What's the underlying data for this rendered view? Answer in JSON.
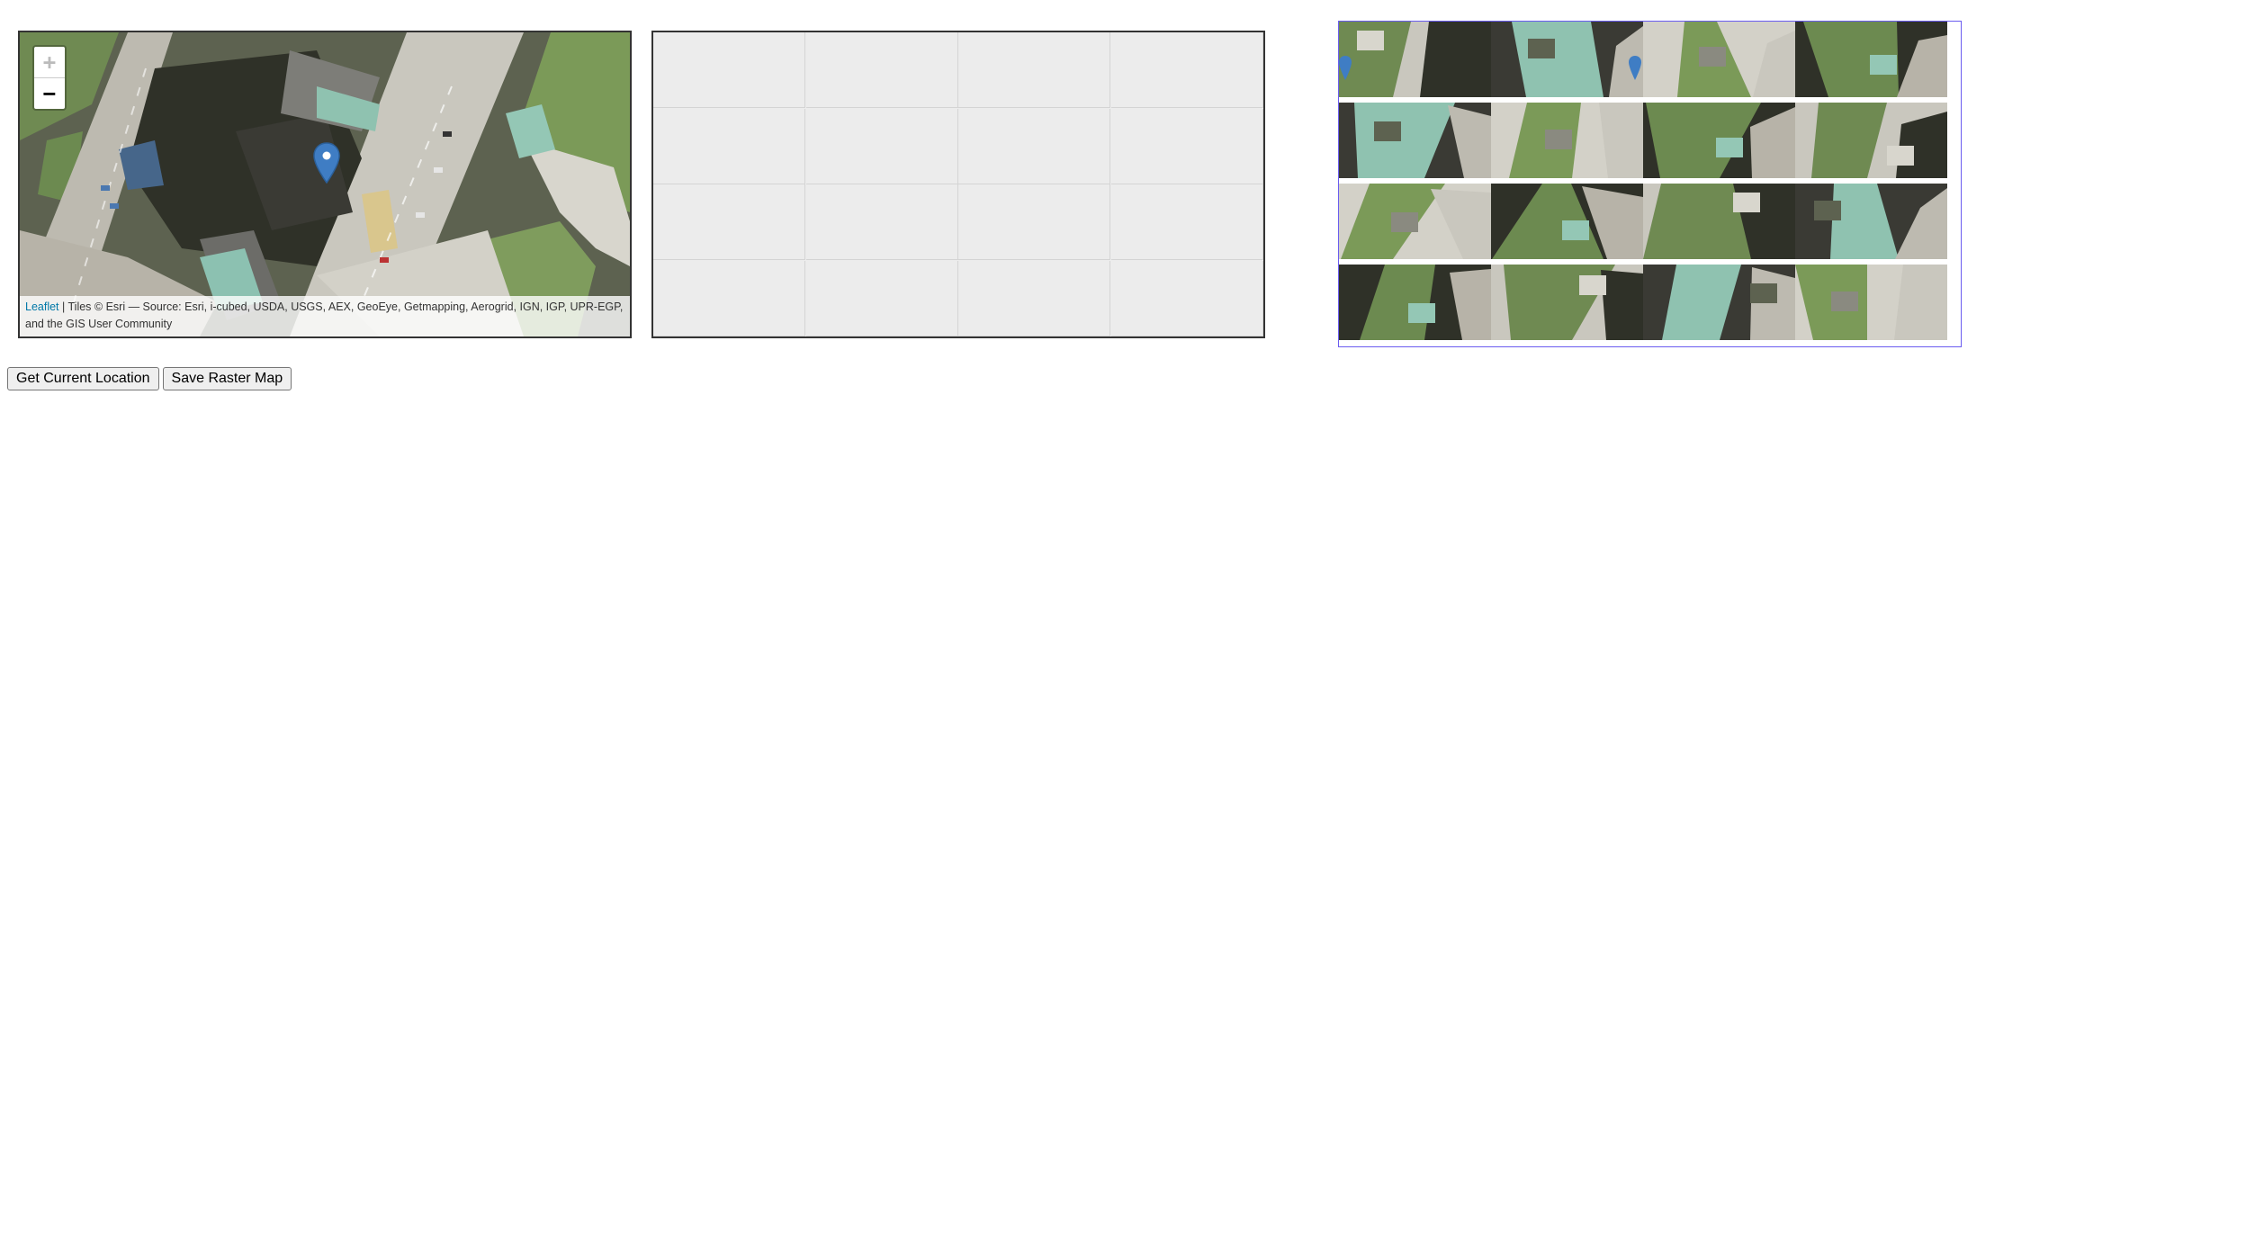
{
  "map": {
    "zoom_in_label": "+",
    "zoom_out_label": "−",
    "attribution_link": "Leaflet",
    "attribution_text": " | Tiles © Esri — Source: Esri, i-cubed, USDA, USGS, AEX, GeoEye, Getmapping, Aerogrid, IGN, IGP, UPR-EGP, and the GIS User Community",
    "marker_color": "#3f7dc4"
  },
  "grid_panel": {
    "rows": 4,
    "cols": 4,
    "background": "#ececec"
  },
  "raster_panel": {
    "rows": 4,
    "cols": 4,
    "border_color": "#6a5cf0"
  },
  "buttons": {
    "get_location": "Get Current Location",
    "save_raster": "Save Raster Map"
  }
}
